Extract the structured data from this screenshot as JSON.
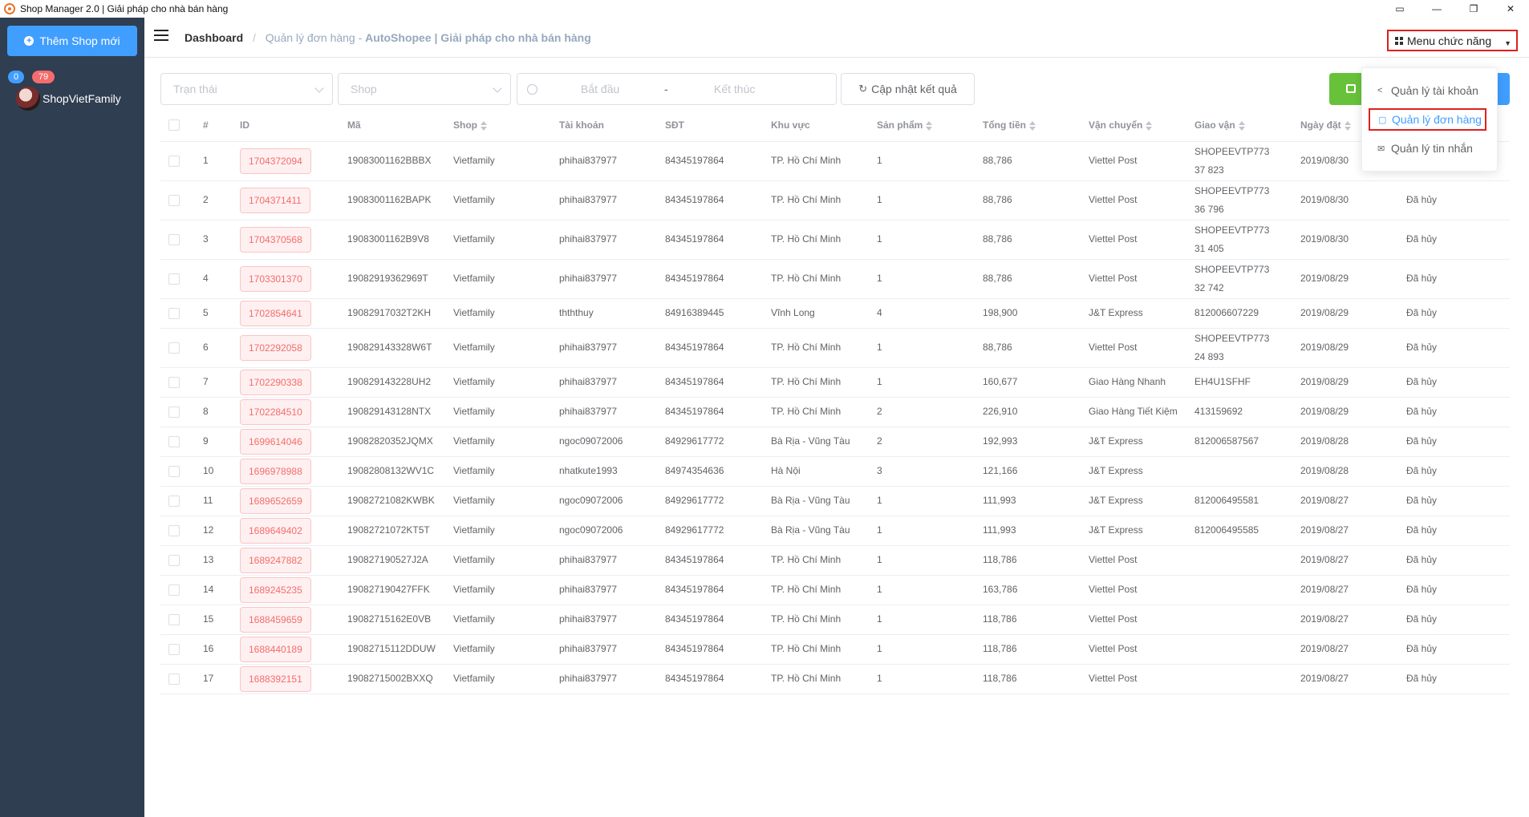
{
  "window": {
    "title": "Shop Manager 2.0 | Giải pháp cho nhà bán hàng",
    "controls": [
      "▭",
      "—",
      "❐",
      "✕"
    ]
  },
  "sidebar": {
    "add_shop_label": "Thêm Shop mới",
    "shop": {
      "badge_blue": "0",
      "badge_red": "79",
      "name": "ShopVietFamily"
    }
  },
  "header": {
    "breadcrumb_home": "Dashboard",
    "breadcrumb_sep": "/",
    "breadcrumb_current_prefix": "Quản lý đơn hàng - ",
    "breadcrumb_current_suffix": "AutoShopee | Giải pháp cho nhà bán hàng",
    "menu_label": "Menu chức năng"
  },
  "menu": {
    "items": [
      {
        "icon": "share-icon",
        "glyph": "<",
        "label": "Quản lý tài khoản",
        "active": false
      },
      {
        "icon": "bag-icon",
        "glyph": "▢",
        "label": "Quản lý đơn hàng",
        "active": true
      },
      {
        "icon": "mail-icon",
        "glyph": "✉",
        "label": "Quản lý tin nhắn",
        "active": false
      }
    ]
  },
  "filters": {
    "status_placeholder": "Trạn thái",
    "shop_placeholder": "Shop",
    "start_placeholder": "Bắt đầu",
    "range_sep": "-",
    "end_placeholder": "Kết thúc",
    "refresh_label": "Cập nhật kết quả"
  },
  "table": {
    "columns": [
      "#",
      "ID",
      "Mã",
      "Shop",
      "Tài khoản",
      "SĐT",
      "Khu vực",
      "Sản phẩm",
      "Tổng tiền",
      "Vận chuyển",
      "Giao vận",
      "Ngày đặt",
      ""
    ],
    "sortable": [
      false,
      false,
      false,
      true,
      false,
      false,
      false,
      true,
      true,
      true,
      true,
      true,
      false
    ],
    "rows": [
      [
        "1",
        "1704372094",
        "19083001162BBBX",
        "Vietfamily",
        "phihai837977",
        "84345197864",
        "TP. Hồ Chí Minh",
        "1",
        "88,786",
        "Viettel Post",
        "SHOPEEVTP77337 823",
        "2019/08/30",
        ""
      ],
      [
        "2",
        "1704371411",
        "19083001162BAPK",
        "Vietfamily",
        "phihai837977",
        "84345197864",
        "TP. Hồ Chí Minh",
        "1",
        "88,786",
        "Viettel Post",
        "SHOPEEVTP77336 796",
        "2019/08/30",
        "Đã hủy"
      ],
      [
        "3",
        "1704370568",
        "19083001162B9V8",
        "Vietfamily",
        "phihai837977",
        "84345197864",
        "TP. Hồ Chí Minh",
        "1",
        "88,786",
        "Viettel Post",
        "SHOPEEVTP77331 405",
        "2019/08/30",
        "Đã hủy"
      ],
      [
        "4",
        "1703301370",
        "19082919362969T",
        "Vietfamily",
        "phihai837977",
        "84345197864",
        "TP. Hồ Chí Minh",
        "1",
        "88,786",
        "Viettel Post",
        "SHOPEEVTP77332 742",
        "2019/08/29",
        "Đã hủy"
      ],
      [
        "5",
        "1702854641",
        "19082917032T2KH",
        "Vietfamily",
        "thththuy",
        "84916389445",
        "Vĩnh Long",
        "4",
        "198,900",
        "J&T Express",
        "812006607229",
        "2019/08/29",
        "Đã hủy"
      ],
      [
        "6",
        "1702292058",
        "190829143328W6T",
        "Vietfamily",
        "phihai837977",
        "84345197864",
        "TP. Hồ Chí Minh",
        "1",
        "88,786",
        "Viettel Post",
        "SHOPEEVTP77324 893",
        "2019/08/29",
        "Đã hủy"
      ],
      [
        "7",
        "1702290338",
        "190829143228UH2",
        "Vietfamily",
        "phihai837977",
        "84345197864",
        "TP. Hồ Chí Minh",
        "1",
        "160,677",
        "Giao Hàng Nhanh",
        "EH4U1SFHF",
        "2019/08/29",
        "Đã hủy"
      ],
      [
        "8",
        "1702284510",
        "190829143128NTX",
        "Vietfamily",
        "phihai837977",
        "84345197864",
        "TP. Hồ Chí Minh",
        "2",
        "226,910",
        "Giao Hàng Tiết Kiệm",
        "413159692",
        "2019/08/29",
        "Đã hủy"
      ],
      [
        "9",
        "1699614046",
        "19082820352JQMX",
        "Vietfamily",
        "ngoc09072006",
        "84929617772",
        "Bà Rịa - Vũng Tàu",
        "2",
        "192,993",
        "J&T Express",
        "812006587567",
        "2019/08/28",
        "Đã hủy"
      ],
      [
        "10",
        "1696978988",
        "19082808132WV1C",
        "Vietfamily",
        "nhatkute1993",
        "84974354636",
        "Hà Nội",
        "3",
        "121,166",
        "J&T Express",
        "",
        "2019/08/28",
        "Đã hủy"
      ],
      [
        "11",
        "1689652659",
        "19082721082KWBK",
        "Vietfamily",
        "ngoc09072006",
        "84929617772",
        "Bà Rịa - Vũng Tàu",
        "1",
        "111,993",
        "J&T Express",
        "812006495581",
        "2019/08/27",
        "Đã hủy"
      ],
      [
        "12",
        "1689649402",
        "19082721072KT5T",
        "Vietfamily",
        "ngoc09072006",
        "84929617772",
        "Bà Rịa - Vũng Tàu",
        "1",
        "111,993",
        "J&T Express",
        "812006495585",
        "2019/08/27",
        "Đã hủy"
      ],
      [
        "13",
        "1689247882",
        "190827190527J2A",
        "Vietfamily",
        "phihai837977",
        "84345197864",
        "TP. Hồ Chí Minh",
        "1",
        "118,786",
        "Viettel Post",
        "",
        "2019/08/27",
        "Đã hủy"
      ],
      [
        "14",
        "1689245235",
        "190827190427FFK",
        "Vietfamily",
        "phihai837977",
        "84345197864",
        "TP. Hồ Chí Minh",
        "1",
        "163,786",
        "Viettel Post",
        "",
        "2019/08/27",
        "Đã hủy"
      ],
      [
        "15",
        "1688459659",
        "19082715162E0VB",
        "Vietfamily",
        "phihai837977",
        "84345197864",
        "TP. Hồ Chí Minh",
        "1",
        "118,786",
        "Viettel Post",
        "",
        "2019/08/27",
        "Đã hủy"
      ],
      [
        "16",
        "1688440189",
        "19082715112DDUW",
        "Vietfamily",
        "phihai837977",
        "84345197864",
        "TP. Hồ Chí Minh",
        "1",
        "118,786",
        "Viettel Post",
        "",
        "2019/08/27",
        "Đã hủy"
      ],
      [
        "17",
        "1688392151",
        "19082715002BXXQ",
        "Vietfamily",
        "phihai837977",
        "84345197864",
        "TP. Hồ Chí Minh",
        "1",
        "118,786",
        "Viettel Post",
        "",
        "2019/08/27",
        "Đã hủy"
      ]
    ]
  },
  "colors": {
    "sidebar_bg": "#2f3e51",
    "primary": "#409eff",
    "success": "#67c23a",
    "danger": "#f56c6c",
    "highlight_border": "#e02020"
  }
}
